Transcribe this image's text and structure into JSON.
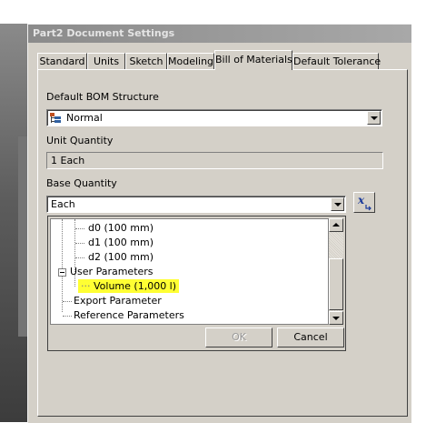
{
  "dialog": {
    "title": "Part2 Document Settings",
    "tabs": [
      {
        "label": "Standard"
      },
      {
        "label": "Units"
      },
      {
        "label": "Sketch"
      },
      {
        "label": "Modeling"
      },
      {
        "label": "Bill of Materials",
        "active": true
      },
      {
        "label": "Default Tolerance"
      }
    ]
  },
  "bom": {
    "structure_label": "Default BOM Structure",
    "structure_value": "Normal",
    "unit_quantity_label": "Unit Quantity",
    "unit_quantity_value": "1 Each",
    "base_quantity_label": "Base Quantity",
    "base_quantity_value": "Each",
    "fx_icon_text": "x"
  },
  "tree": {
    "items": [
      {
        "label": "d0 (100 mm)"
      },
      {
        "label": "d1 (100 mm)"
      },
      {
        "label": "d2 (100 mm)"
      },
      {
        "label": "User Parameters"
      },
      {
        "label": "Volume (1,000 l)",
        "highlighted": true
      },
      {
        "label": "Export Parameter"
      },
      {
        "label": "Reference Parameters"
      }
    ]
  },
  "buttons": {
    "ok": "OK",
    "cancel": "Cancel"
  },
  "colors": {
    "highlight": "#ffff33",
    "dialog_face": "#d4d0c8",
    "titlebar": "#9a9a9a"
  }
}
